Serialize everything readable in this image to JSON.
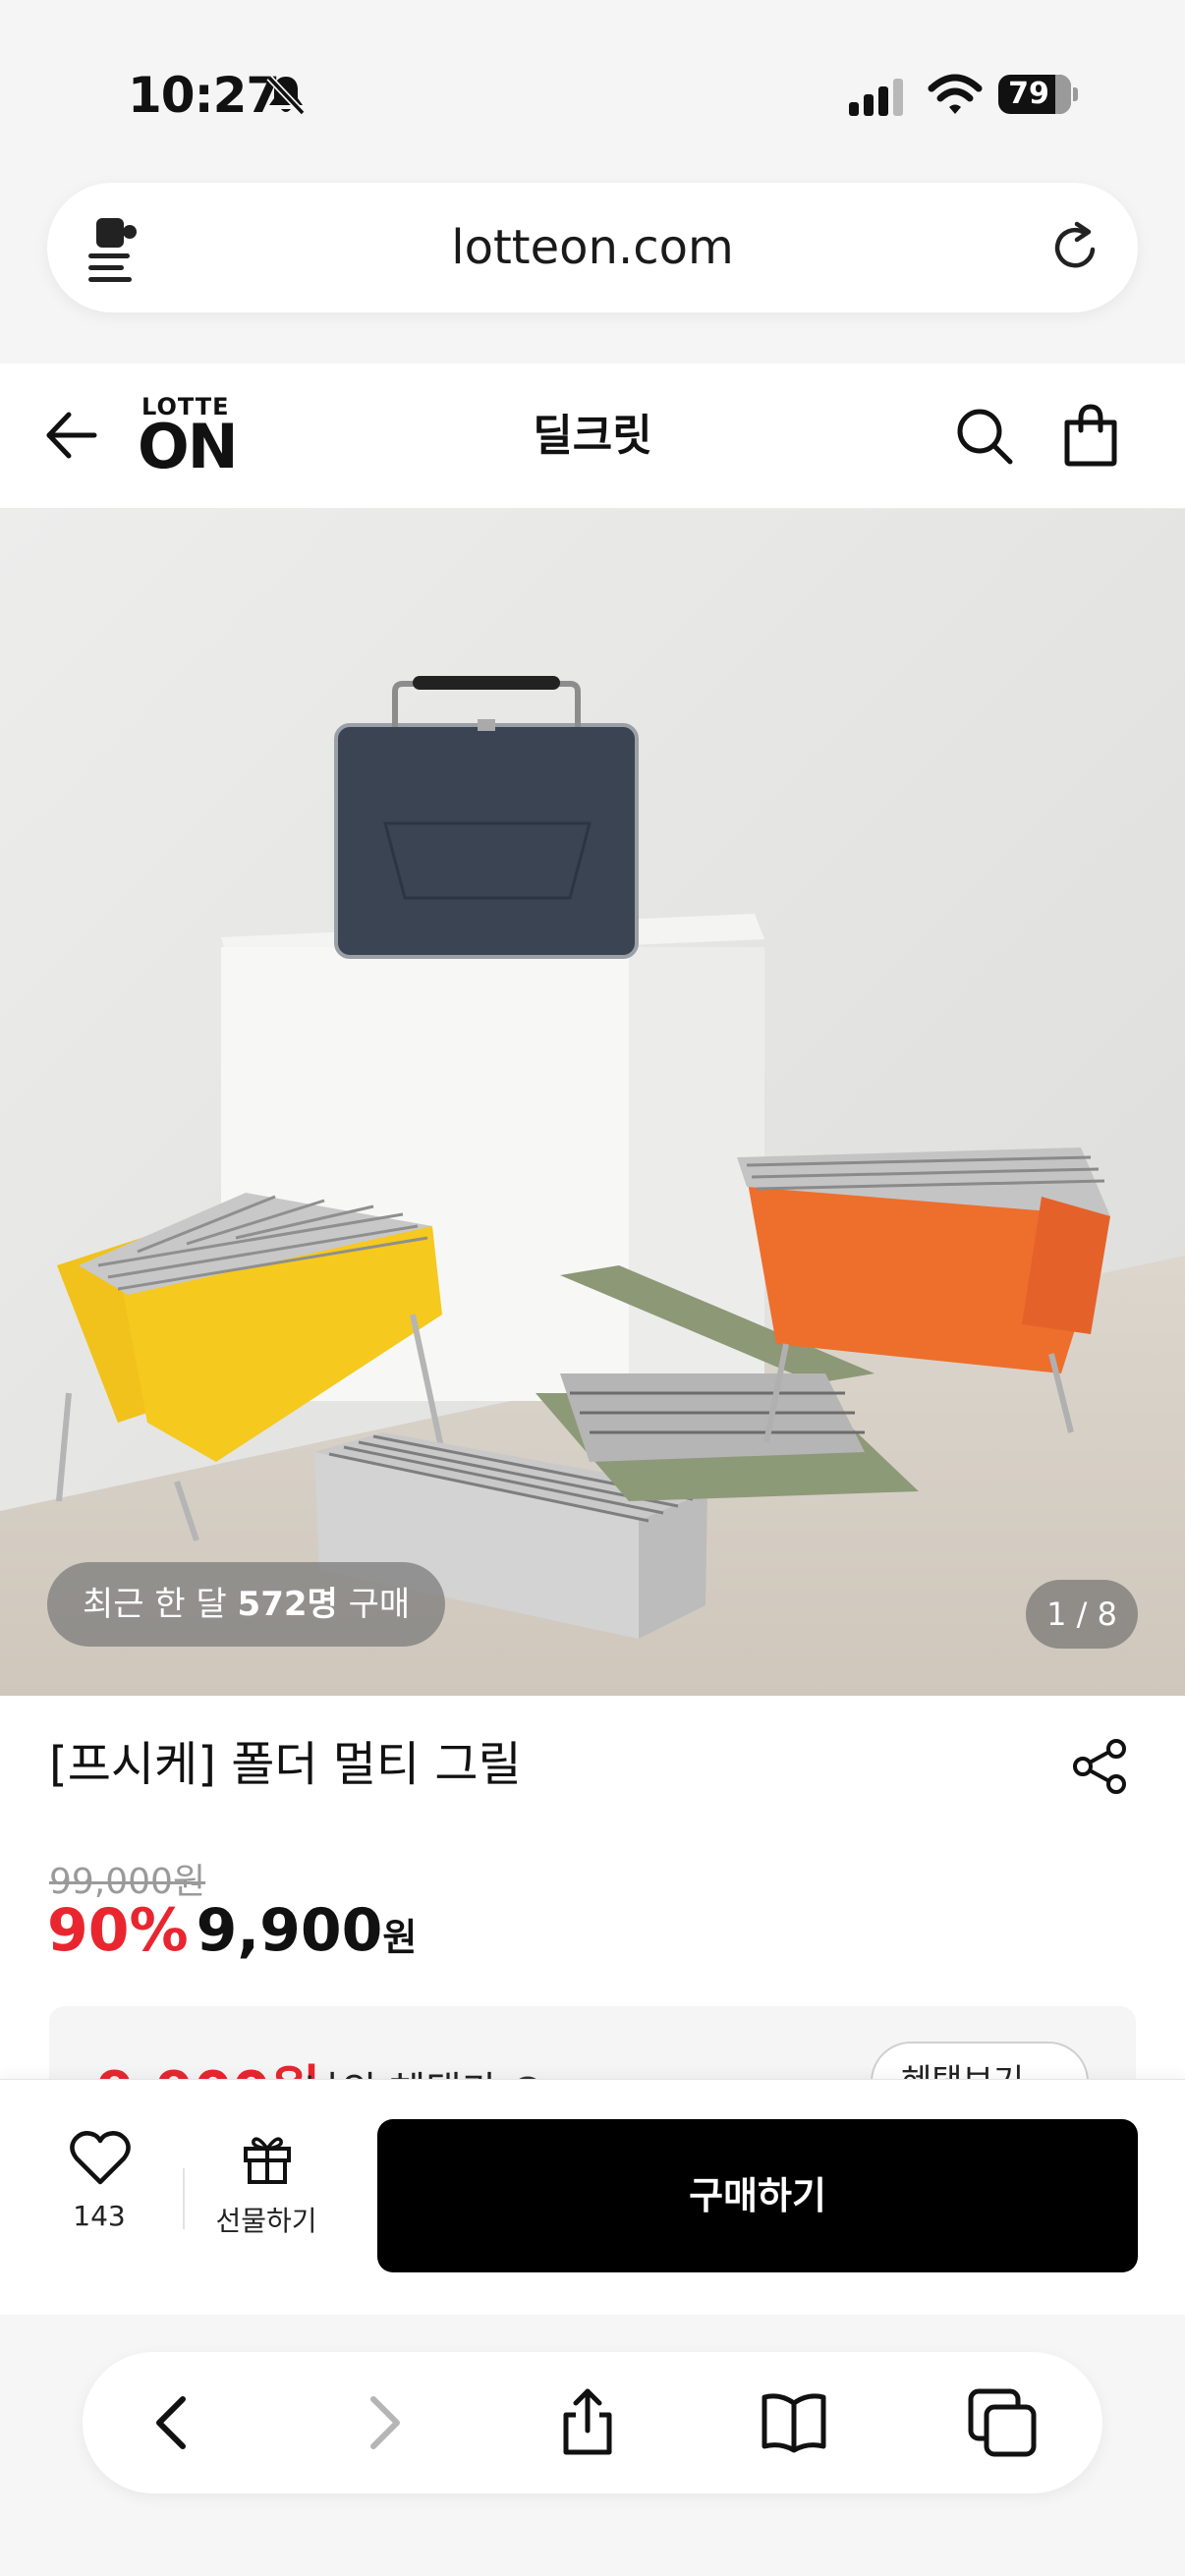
{
  "status_bar": {
    "time": "10:27",
    "battery": "79"
  },
  "browser": {
    "url": "lotteon.com"
  },
  "header": {
    "logo_top": "LOTTE",
    "logo_main": "ON",
    "title": "딜크릿"
  },
  "hero": {
    "recent_prefix": "최근 한 달 ",
    "recent_count": "572명",
    "recent_suffix": " 구매",
    "page_indicator": "1 / 8"
  },
  "product": {
    "title": "[프시케] 폴더 멀티 그릴",
    "original_price": "99,000원",
    "discount": "90%",
    "sale_price": "9,900",
    "currency": "원",
    "benefit_price": "9,900원",
    "benefit_label": "나의 혜택가",
    "benefit_button": "혜택보기"
  },
  "action_bar": {
    "like_count": "143",
    "gift_label": "선물하기",
    "buy_label": "구매하기"
  },
  "colors": {
    "accent_red": "#e9262f",
    "buy_button": "#000000"
  },
  "icons": [
    "bell-slash-icon",
    "signal-icon",
    "wifi-icon",
    "battery-icon",
    "extension-icon",
    "reload-icon",
    "back-arrow-icon",
    "search-icon",
    "shopping-bag-icon",
    "share-icon",
    "heart-icon",
    "gift-icon",
    "chevron-left-icon",
    "chevron-right-icon",
    "share-up-icon",
    "book-icon",
    "tabs-icon"
  ]
}
